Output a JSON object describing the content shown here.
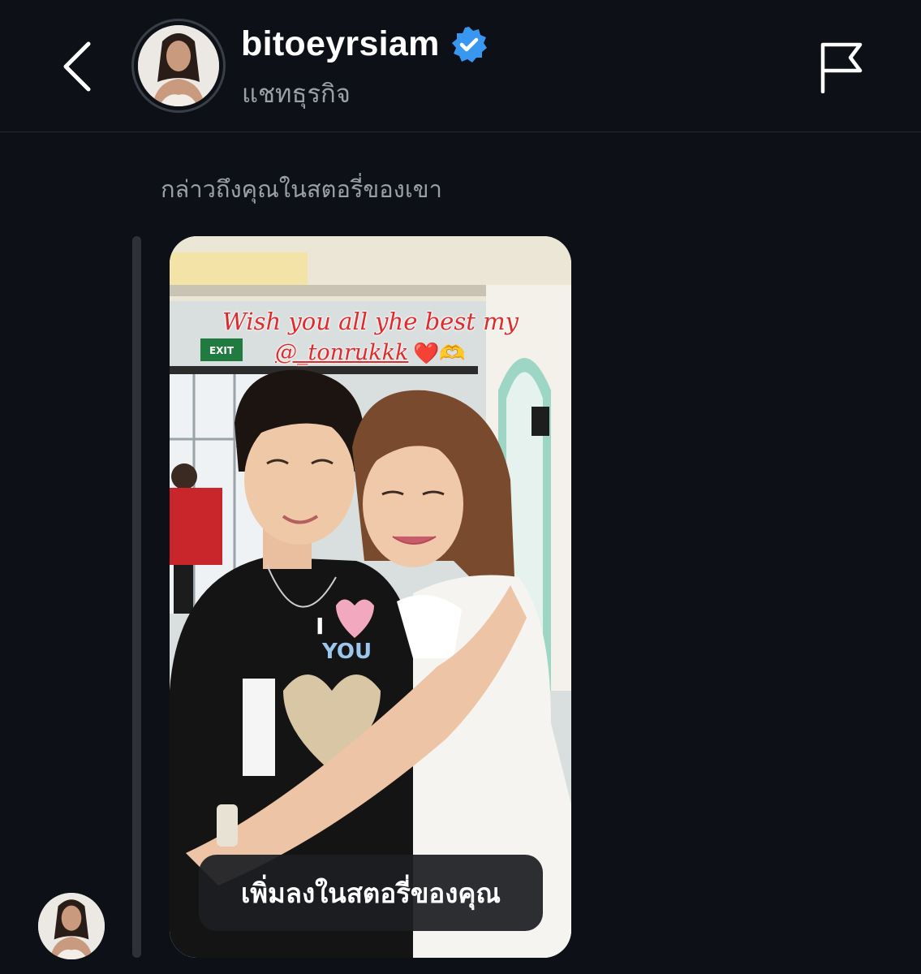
{
  "header": {
    "username": "bitoeyrsiam",
    "subtitle": "แชทธุรกิจ",
    "back_icon": "chevron-left-icon",
    "verified_icon": "verified-badge-icon",
    "flag_icon": "flag-icon"
  },
  "message": {
    "mention_text": "กล่าวถึงคุณในสตอรี่ของเขา",
    "story": {
      "caption_line1": "Wish you all yhe best my",
      "caption_mention": "@_tonrukkk",
      "caption_emoji": "❤️🫶",
      "exit_sign": "EXIT",
      "shirt_text_1": "I",
      "shirt_text_2": "YOU",
      "add_to_story_label": "เพิ่มลงในสตอรี่ของคุณ"
    }
  },
  "colors": {
    "background": "#0d1117",
    "verified_blue": "#3897f0",
    "caption_red": "#e02b2b",
    "muted_text": "#9aa0a8"
  }
}
